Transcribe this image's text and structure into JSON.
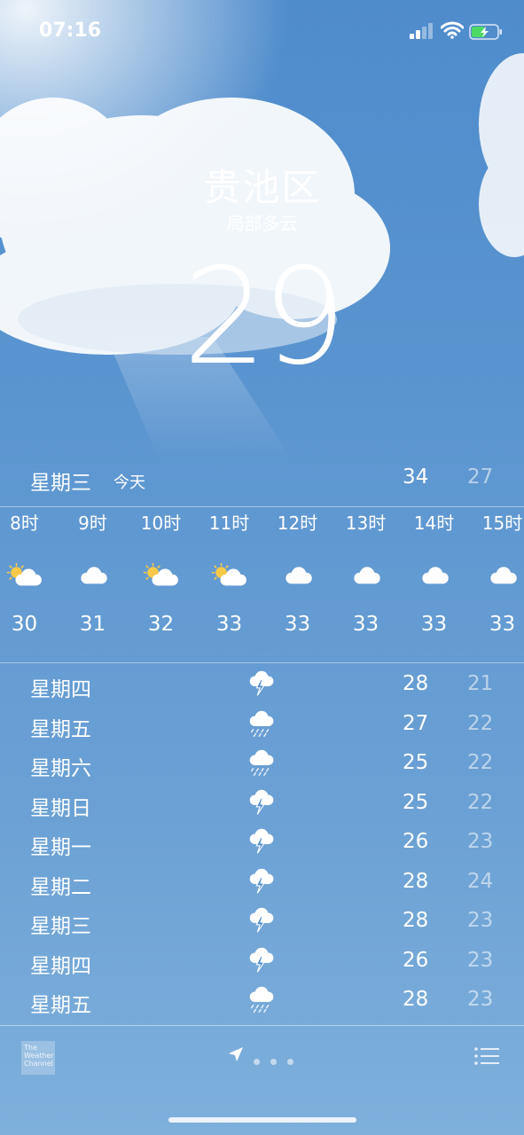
{
  "status_bar": {
    "time": "07:16"
  },
  "header": {
    "city": "贵池区",
    "condition": "局部多云",
    "temperature": "29"
  },
  "today": {
    "day": "星期三",
    "label": "今天",
    "high": "34",
    "low": "27"
  },
  "hourly": [
    {
      "hour": "8时",
      "icon": "partly-sunny-icon",
      "temp": "30"
    },
    {
      "hour": "9时",
      "icon": "cloud-icon",
      "temp": "31"
    },
    {
      "hour": "10时",
      "icon": "partly-sunny-icon",
      "temp": "32"
    },
    {
      "hour": "11时",
      "icon": "partly-sunny-icon",
      "temp": "33"
    },
    {
      "hour": "12时",
      "icon": "cloud-icon",
      "temp": "33"
    },
    {
      "hour": "13时",
      "icon": "cloud-icon",
      "temp": "33"
    },
    {
      "hour": "14时",
      "icon": "cloud-icon",
      "temp": "33"
    },
    {
      "hour": "15时",
      "icon": "cloud-icon",
      "temp": "33"
    }
  ],
  "daily": [
    {
      "day": "星期四",
      "icon": "thunderstorm-icon",
      "high": "28",
      "low": "21"
    },
    {
      "day": "星期五",
      "icon": "rain-icon",
      "high": "27",
      "low": "22"
    },
    {
      "day": "星期六",
      "icon": "rain-icon",
      "high": "25",
      "low": "22"
    },
    {
      "day": "星期日",
      "icon": "thunderstorm-icon",
      "high": "25",
      "low": "22"
    },
    {
      "day": "星期一",
      "icon": "thunderstorm-icon",
      "high": "26",
      "low": "23"
    },
    {
      "day": "星期二",
      "icon": "thunderstorm-icon",
      "high": "28",
      "low": "24"
    },
    {
      "day": "星期三",
      "icon": "thunderstorm-icon",
      "high": "28",
      "low": "23"
    },
    {
      "day": "星期四",
      "icon": "thunderstorm-icon",
      "high": "26",
      "low": "23"
    },
    {
      "day": "星期五",
      "icon": "rain-icon",
      "high": "28",
      "low": "23"
    }
  ],
  "footer": {
    "logo_text": "The Weather Channel",
    "page_dots": 3
  }
}
